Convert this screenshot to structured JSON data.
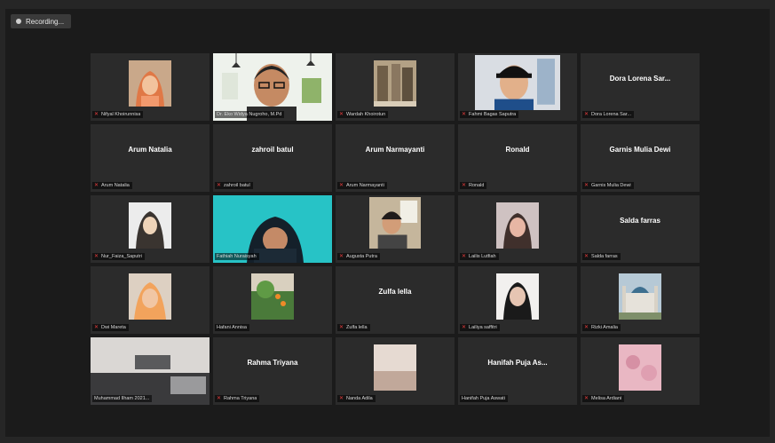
{
  "recording": {
    "label": "Recording..."
  },
  "colors": {
    "background": "#262626",
    "tile": "#2b2b2b",
    "active_border": "#d8e32a",
    "muted_mic": "#e23b3b"
  },
  "participants": [
    {
      "label": "Nifyal Khoirunnisa",
      "display": "",
      "muted": true,
      "video": "hijab-orange"
    },
    {
      "label": "Dr. Eko Widya Nugroho, M.Pd",
      "display": "",
      "muted": false,
      "video": "man-glasses",
      "active": true
    },
    {
      "label": "Wardah Khoirotun",
      "display": "",
      "muted": true,
      "video": "shelf"
    },
    {
      "label": "Fahmi Bagas Saputra",
      "display": "",
      "muted": true,
      "video": "man-cap"
    },
    {
      "label": "Dora Lorena Sar...",
      "display": "Dora Lorena Sar...",
      "muted": true,
      "video": "none"
    },
    {
      "label": "Arum Natalia",
      "display": "Arum Natalia",
      "muted": true,
      "video": "none"
    },
    {
      "label": "zahroil batul",
      "display": "zahroil batul",
      "muted": true,
      "video": "none"
    },
    {
      "label": "Arum Narmayanti",
      "display": "Arum Narmayanti",
      "muted": true,
      "video": "none"
    },
    {
      "label": "Ronald",
      "display": "Ronald",
      "muted": true,
      "video": "none"
    },
    {
      "label": "Garnis Mulia Dewi",
      "display": "Garnis Mulia Dewi",
      "muted": true,
      "video": "none"
    },
    {
      "label": "Nur_Faiza_Saputri",
      "display": "",
      "muted": true,
      "video": "hijab-beige"
    },
    {
      "label": "Fathiah Nuraisyah",
      "display": "",
      "muted": false,
      "video": "cyan-hijab"
    },
    {
      "label": "Augusta Putra",
      "display": "",
      "muted": true,
      "video": "boy-window"
    },
    {
      "label": "Lailis Lutfiah",
      "display": "",
      "muted": true,
      "video": "girl-pink"
    },
    {
      "label": "Salda farras",
      "display": "Salda farras",
      "muted": true,
      "video": "none"
    },
    {
      "label": "Dwi Mareta",
      "display": "",
      "muted": true,
      "video": "hijab-orange2"
    },
    {
      "label": "Hafani Annisa",
      "display": "",
      "muted": false,
      "video": "plant"
    },
    {
      "label": "Zulfa lella",
      "display": "Zulfa lella",
      "muted": true,
      "video": "none"
    },
    {
      "label": "Lailiya saffitri",
      "display": "",
      "muted": true,
      "video": "girl-white"
    },
    {
      "label": "Rizki Amalia",
      "display": "",
      "muted": true,
      "video": "mosque"
    },
    {
      "label": "Muhammad Ilham 2021...",
      "display": "",
      "muted": false,
      "video": "car-room"
    },
    {
      "label": "Rahma Triyana",
      "display": "Rahma Triyana",
      "muted": true,
      "video": "none"
    },
    {
      "label": "Nanda Adila",
      "display": "",
      "muted": true,
      "video": "room"
    },
    {
      "label": "Hanifah Puja Aswati",
      "display": "Hanifah Puja As...",
      "muted": false,
      "video": "none"
    },
    {
      "label": "Melisa Ardiani",
      "display": "",
      "muted": true,
      "video": "pink-fabric"
    }
  ]
}
